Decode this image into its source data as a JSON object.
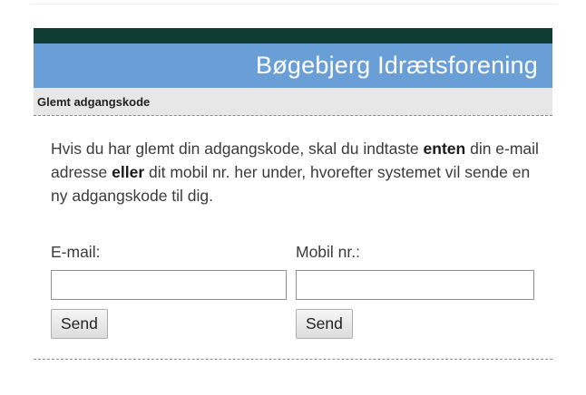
{
  "header": {
    "site_title": "Bøgebjerg Idrætsforening",
    "colors": {
      "dark_bar": "#0f3d33",
      "title_bar": "#6a9ed6"
    }
  },
  "subheader": {
    "title": "Glemt adgangskode"
  },
  "intro": {
    "part1": "Hvis du har glemt din adgangskode, skal du indtaste ",
    "bold1": "enten",
    "part2": " din e-mail adresse ",
    "bold2": "eller",
    "part3": " dit mobil nr. her under, hvorefter systemet vil sende en ny adgangskode til dig."
  },
  "form": {
    "email": {
      "label": "E-mail:",
      "value": "",
      "button_label": "Send"
    },
    "mobile": {
      "label": "Mobil nr.:",
      "value": "",
      "button_label": "Send"
    }
  }
}
